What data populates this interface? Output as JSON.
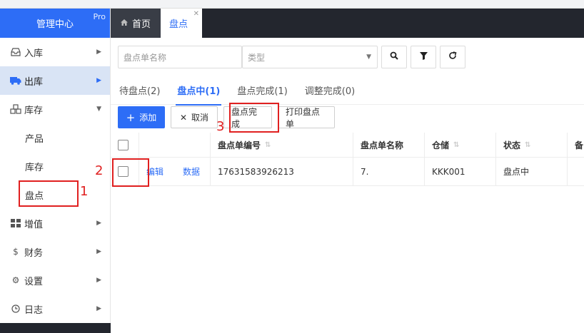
{
  "sidebar": {
    "brand": "管理中心",
    "pro_badge": "Pro",
    "items": [
      {
        "label": "入库",
        "icon": "inbox-icon"
      },
      {
        "label": "出库",
        "icon": "truck-icon"
      },
      {
        "label": "库存",
        "icon": "cubes-icon"
      },
      {
        "label": "增值",
        "icon": "grid-icon"
      },
      {
        "label": "财务",
        "icon": "dollar-icon"
      },
      {
        "label": "设置",
        "icon": "gears-icon"
      },
      {
        "label": "日志",
        "icon": "clock-icon"
      }
    ],
    "sub_items": [
      "产品",
      "库存",
      "盘点"
    ]
  },
  "topbar": {
    "home_tab": "首页",
    "active_tab": "盘点"
  },
  "filters": {
    "name_placeholder": "盘点单名称",
    "type_placeholder": "类型"
  },
  "status_tabs": [
    {
      "label": "待盘点(2)"
    },
    {
      "label": "盘点中(1)"
    },
    {
      "label": "盘点完成(1)"
    },
    {
      "label": "调整完成(0)"
    }
  ],
  "actions": {
    "add": "添加",
    "cancel": "取消",
    "complete": "盘点完成",
    "print": "打印盘点单"
  },
  "table": {
    "headers": [
      "盘点单编号",
      "盘点单名称",
      "仓储",
      "状态",
      "备"
    ],
    "rows": [
      {
        "edit": "编辑",
        "data": "数据",
        "code": "17631583926213",
        "name": "7.",
        "warehouse": "KKK001",
        "status": "盘点中"
      }
    ]
  },
  "annotations": {
    "n1": "1",
    "n2": "2",
    "n3": "3"
  },
  "colors": {
    "accent": "#2d6df6",
    "dark": "#23262e",
    "annotation": "#e02020"
  }
}
